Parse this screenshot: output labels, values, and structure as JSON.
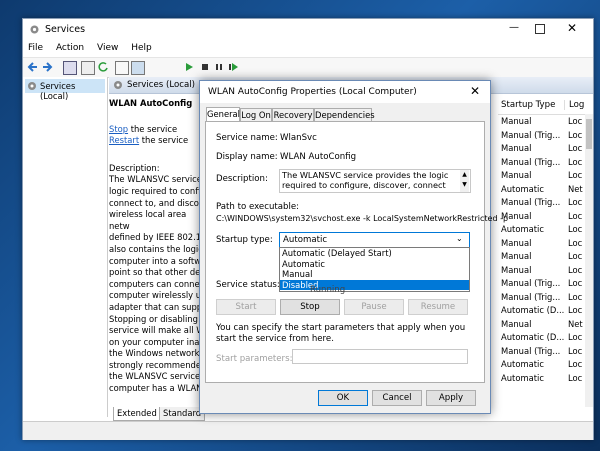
{
  "services_window": {
    "title": "Services",
    "menu": [
      "File",
      "Action",
      "View",
      "Help"
    ],
    "tree_item": "Services (Local)",
    "header_title": "Services (Local)",
    "selected_service": "WLAN AutoConfig",
    "stop_link": "Stop",
    "stop_suffix": " the service",
    "restart_link": "Restart",
    "restart_suffix": " the service",
    "description_label": "Description:",
    "description_lines": [
      "The WLANSVC service",
      "logic required to config",
      "connect to, and discon",
      "wireless local area netw",
      "defined by IEEE 802.11",
      "also contains the logic",
      "computer into a softwa",
      "point so that other dev",
      "computers can connect",
      "computer wirelessly us",
      "adapter that can suppo",
      "Stopping or disabling t",
      "service will make all Wl",
      "on your computer inacc",
      "the Windows networkin",
      "strongly recommended",
      "the WLANSVC service r",
      "computer has a WLAN"
    ],
    "columns": {
      "startup_type": "Startup Type",
      "log_on": "Log"
    },
    "rows": [
      [
        "Manual",
        "Loc"
      ],
      [
        "Manual (Trig...",
        "Loc"
      ],
      [
        "Manual",
        "Loc"
      ],
      [
        "Manual (Trig...",
        "Loc"
      ],
      [
        "Manual",
        "Loc"
      ],
      [
        "Automatic",
        "Net"
      ],
      [
        "Manual (Trig...",
        "Loc"
      ],
      [
        "Manual",
        "Loc"
      ],
      [
        "Automatic",
        "Loc"
      ],
      [
        "Manual",
        "Loc"
      ],
      [
        "Manual",
        "Loc"
      ],
      [
        "Manual",
        "Loc"
      ],
      [
        "Manual (Trig...",
        "Loc"
      ],
      [
        "Manual (Trig...",
        "Loc"
      ],
      [
        "Automatic (D...",
        "Loc"
      ],
      [
        "Manual",
        "Net"
      ],
      [
        "Automatic (D...",
        "Loc"
      ],
      [
        "Manual (Trig...",
        "Loc"
      ],
      [
        "Automatic",
        "Loc"
      ],
      [
        "Automatic",
        "Loc"
      ]
    ],
    "bottom_tabs": [
      "Extended",
      "Standard"
    ]
  },
  "dialog": {
    "title": "WLAN AutoConfig Properties (Local Computer)",
    "tabs": [
      "General",
      "Log On",
      "Recovery",
      "Dependencies"
    ],
    "active_tab": "General",
    "service_name_label": "Service name:",
    "service_name_value": "WlanSvc",
    "display_name_label": "Display name:",
    "display_name_value": "WLAN AutoConfig",
    "description_label": "Description:",
    "description_text": "The WLANSVC service provides the logic required to configure, discover, connect to, and disconnect",
    "path_label": "Path to executable:",
    "path_value": "C:\\WINDOWS\\system32\\svchost.exe -k LocalSystemNetworkRestricted -p",
    "startup_type_label": "Startup type:",
    "startup_type_value": "Automatic",
    "startup_options": [
      "Automatic (Delayed Start)",
      "Automatic",
      "Manual",
      "Disabled"
    ],
    "highlighted_option": "Disabled",
    "service_status_label": "Service status:",
    "service_status_value": "Running",
    "start_button": "Start",
    "stop_button": "Stop",
    "pause_button": "Pause",
    "resume_button": "Resume",
    "params_note": "You can specify the start parameters that apply when you start the service from here.",
    "start_parameters_label": "Start parameters:",
    "start_parameters_value": "",
    "ok_button": "OK",
    "cancel_button": "Cancel",
    "apply_button": "Apply"
  },
  "colors": {
    "accent": "#0078d7",
    "link": "#1a5ec2",
    "selection": "#0078d7"
  }
}
